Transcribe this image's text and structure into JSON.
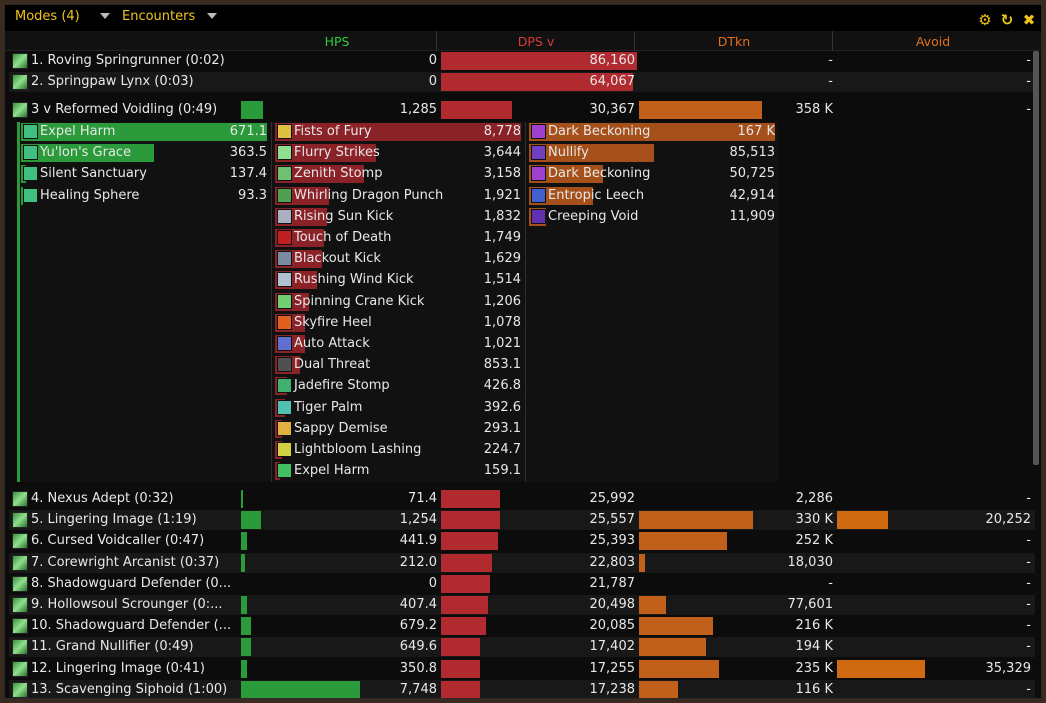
{
  "titlebar": {
    "modes_label": "Modes (4)",
    "encounters_label": "Encounters",
    "icons": [
      "gear-icon",
      "reset-icon",
      "close-icon"
    ]
  },
  "columns": {
    "hps": "HPS",
    "dps": "DPS v",
    "dtkn": "DTkn",
    "avoid": "Avoid"
  },
  "colors": {
    "hps_header": "#2ecc40",
    "dps_header": "#d83a3a",
    "dtkn_header": "#e0701e",
    "avoid_header": "#e0701e",
    "hps_bar": "#2a9a3a",
    "dps_bar": "#b02a30",
    "dtkn_bar": "#c0601a"
  },
  "top_rows": [
    {
      "name": "1. Roving Springrunner (0:02)",
      "hps": "0",
      "dps": "86,160",
      "dtkn": "-",
      "avoid": "-",
      "dps_frac": 1.0,
      "hps_frac": 0,
      "dtkn_frac": 0,
      "avoid_frac": 0
    },
    {
      "name": "2. Springpaw Lynx (0:03)",
      "hps": "0",
      "dps": "64,067",
      "dtkn": "-",
      "avoid": "-",
      "dps_frac": 0.98,
      "hps_frac": 0,
      "dtkn_frac": 0,
      "avoid_frac": 0
    }
  ],
  "expanded_row": {
    "name": "3 v Reformed Voidling (0:49)",
    "hps": "1,285",
    "dps": "30,367",
    "dtkn": "358 K",
    "avoid": "-",
    "hps_frac": 0.11,
    "dps_frac": 0.36,
    "dtkn_frac": 0.63,
    "avoid_frac": 0
  },
  "breakdown": {
    "hps": [
      {
        "name": "Expel Harm",
        "value": "671.1",
        "frac": 1.0
      },
      {
        "name": "Yu'lon's Grace",
        "value": "363.5",
        "frac": 0.54
      },
      {
        "name": "Silent Sanctuary",
        "value": "137.4",
        "frac": 0.02
      },
      {
        "name": "Healing Sphere",
        "value": "93.3",
        "frac": 0.01
      }
    ],
    "dps": [
      {
        "name": "Fists of Fury",
        "value": "8,778",
        "frac": 1.0,
        "color": "#e0c040"
      },
      {
        "name": "Flurry Strikes",
        "value": "3,644",
        "frac": 0.41,
        "color": "#8ee08e"
      },
      {
        "name": "Zenith Stomp",
        "value": "3,158",
        "frac": 0.36,
        "color": "#6fc06f"
      },
      {
        "name": "Whirling Dragon Punch",
        "value": "1,921",
        "frac": 0.22,
        "color": "#50a050"
      },
      {
        "name": "Rising Sun Kick",
        "value": "1,832",
        "frac": 0.21,
        "color": "#aab0c0"
      },
      {
        "name": "Touch of Death",
        "value": "1,749",
        "frac": 0.2,
        "color": "#c02020"
      },
      {
        "name": "Blackout Kick",
        "value": "1,629",
        "frac": 0.19,
        "color": "#7a8aa0"
      },
      {
        "name": "Rushing Wind Kick",
        "value": "1,514",
        "frac": 0.17,
        "color": "#b0c0d0"
      },
      {
        "name": "Spinning Crane Kick",
        "value": "1,206",
        "frac": 0.14,
        "color": "#70d070"
      },
      {
        "name": "Skyfire Heel",
        "value": "1,078",
        "frac": 0.12,
        "color": "#e06020"
      },
      {
        "name": "Auto Attack",
        "value": "1,021",
        "frac": 0.12,
        "color": "#6070d0"
      },
      {
        "name": "Dual Threat",
        "value": "853.1",
        "frac": 0.1,
        "color": "#505050"
      },
      {
        "name": "Jadefire Stomp",
        "value": "426.8",
        "frac": 0.05,
        "color": "#40b070"
      },
      {
        "name": "Tiger Palm",
        "value": "392.6",
        "frac": 0.04,
        "color": "#50c0b0"
      },
      {
        "name": "Sappy Demise",
        "value": "293.1",
        "frac": 0.03,
        "color": "#e0b040"
      },
      {
        "name": "Lightbloom Lashing",
        "value": "224.7",
        "frac": 0.03,
        "color": "#d0d040"
      },
      {
        "name": "Expel Harm",
        "value": "159.1",
        "frac": 0.02,
        "color": "#40c060"
      }
    ],
    "dtkn": [
      {
        "name": "Dark Beckoning",
        "value": "167 K",
        "frac": 1.0,
        "color": "#a040d0"
      },
      {
        "name": "Nullify",
        "value": "85,513",
        "frac": 0.51,
        "color": "#7040c0"
      },
      {
        "name": "Dark Beckoning",
        "value": "50,725",
        "frac": 0.3,
        "color": "#a040d0"
      },
      {
        "name": "Entropic Leech",
        "value": "42,914",
        "frac": 0.26,
        "color": "#4060d0"
      },
      {
        "name": "Creeping Void",
        "value": "11,909",
        "frac": 0.07,
        "color": "#6030b0"
      }
    ]
  },
  "bottom_rows": [
    {
      "name": "4. Nexus Adept (0:32)",
      "hps": "71.4",
      "dps": "25,992",
      "dtkn": "2,286",
      "avoid": "-",
      "hps_frac": 0.01,
      "dps_frac": 0.3,
      "dtkn_frac": 0.0,
      "avoid_frac": 0
    },
    {
      "name": "5. Lingering Image (1:19)",
      "hps": "1,254",
      "dps": "25,557",
      "dtkn": "330 K",
      "avoid": "20,252",
      "hps_frac": 0.1,
      "dps_frac": 0.3,
      "dtkn_frac": 0.58,
      "avoid_frac": 0.26
    },
    {
      "name": "6. Cursed Voidcaller (0:47)",
      "hps": "441.9",
      "dps": "25,393",
      "dtkn": "252 K",
      "avoid": "-",
      "hps_frac": 0.03,
      "dps_frac": 0.29,
      "dtkn_frac": 0.45,
      "avoid_frac": 0
    },
    {
      "name": "7. Corewright Arcanist (0:37)",
      "hps": "212.0",
      "dps": "22,803",
      "dtkn": "18,030",
      "avoid": "-",
      "hps_frac": 0.02,
      "dps_frac": 0.26,
      "dtkn_frac": 0.03,
      "avoid_frac": 0
    },
    {
      "name": "8. Shadowguard Defender (0...",
      "hps": "0",
      "dps": "21,787",
      "dtkn": "-",
      "avoid": "-",
      "hps_frac": 0,
      "dps_frac": 0.25,
      "dtkn_frac": 0,
      "avoid_frac": 0
    },
    {
      "name": "9. Hollowsoul Scrounger (0:...",
      "hps": "407.4",
      "dps": "20,498",
      "dtkn": "77,601",
      "avoid": "-",
      "hps_frac": 0.03,
      "dps_frac": 0.24,
      "dtkn_frac": 0.14,
      "avoid_frac": 0
    },
    {
      "name": "10. Shadowguard Defender (...",
      "hps": "679.2",
      "dps": "20,085",
      "dtkn": "216 K",
      "avoid": "-",
      "hps_frac": 0.05,
      "dps_frac": 0.23,
      "dtkn_frac": 0.38,
      "avoid_frac": 0
    },
    {
      "name": "11. Grand Nullifier (0:49)",
      "hps": "649.6",
      "dps": "17,402",
      "dtkn": "194 K",
      "avoid": "-",
      "hps_frac": 0.05,
      "dps_frac": 0.2,
      "dtkn_frac": 0.34,
      "avoid_frac": 0
    },
    {
      "name": "12. Lingering Image (0:41)",
      "hps": "350.8",
      "dps": "17,255",
      "dtkn": "235 K",
      "avoid": "35,329",
      "hps_frac": 0.03,
      "dps_frac": 0.2,
      "dtkn_frac": 0.41,
      "avoid_frac": 0.45
    },
    {
      "name": "13. Scavenging Siphoid (1:00)",
      "hps": "7,748",
      "dps": "17,238",
      "dtkn": "116 K",
      "avoid": "-",
      "hps_frac": 0.6,
      "dps_frac": 0.2,
      "dtkn_frac": 0.2,
      "avoid_frac": 0
    }
  ]
}
